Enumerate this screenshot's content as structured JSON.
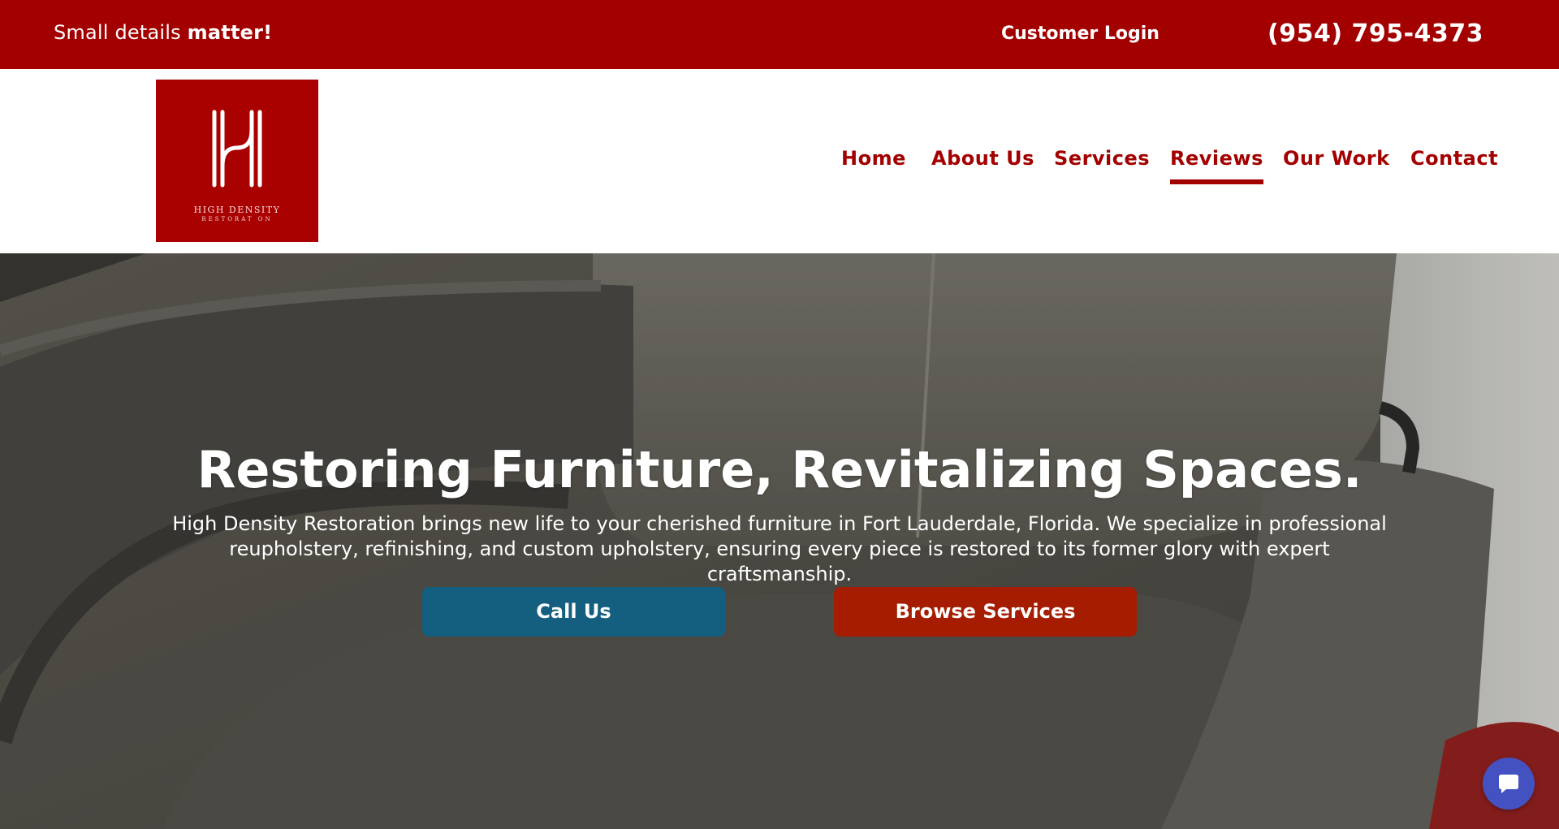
{
  "topbar": {
    "tagline_prefix": "Small details ",
    "tagline_bold": "matter!",
    "login_label": "Customer Login",
    "phone": "(954) 795-4373"
  },
  "logo": {
    "line1": "HIGH DENSITY",
    "line2": "RESTORAT ON"
  },
  "nav": {
    "items": [
      {
        "label": "Home"
      },
      {
        "label": "About Us"
      },
      {
        "label": "Services"
      },
      {
        "label": "Reviews",
        "active": true
      },
      {
        "label": "Our Work"
      },
      {
        "label": "Contact"
      }
    ]
  },
  "hero": {
    "title": "Restoring Furniture, Revitalizing Spaces.",
    "description": "High Density Restoration brings new life to your cherished furniture in Fort Lauderdale, Florida. We specialize in professional reupholstery, refinishing, and custom upholstery, ensuring every piece is restored to its former glory with expert craftsmanship.",
    "call_label": "Call Us",
    "browse_label": "Browse Services"
  },
  "icons": {
    "chat": "chat-bubble-icon",
    "logo_mark": "h-monogram-icon"
  },
  "colors": {
    "brand_red": "#a30000",
    "call_blue": "#145e80",
    "browse_red": "#a51c00",
    "chat_blue": "#4452c1"
  }
}
